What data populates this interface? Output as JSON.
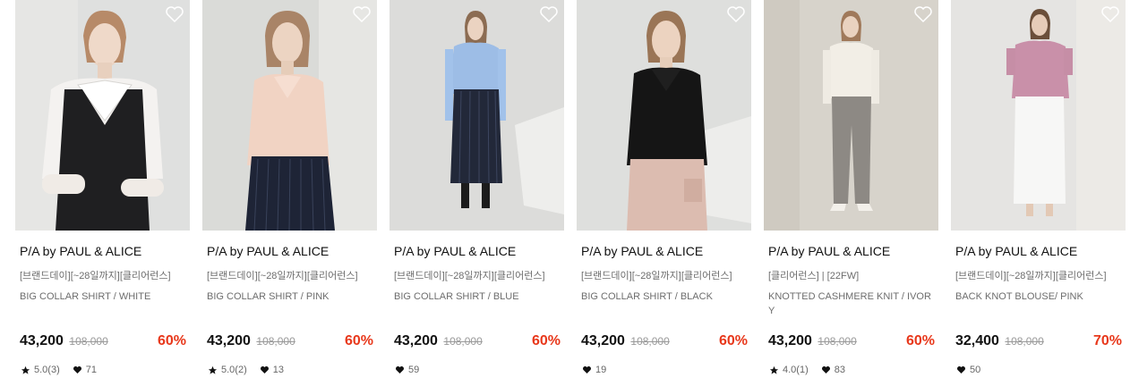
{
  "colors": {
    "discount": "#e8381b",
    "text_primary": "#111111",
    "text_secondary": "#6d6d6d",
    "strike": "#9a9a9a"
  },
  "icons": {
    "wishlist": "heart-outline-icon",
    "rating": "star-icon",
    "likes": "heart-icon"
  },
  "products": [
    {
      "brand": "P/A by PAUL & ALICE",
      "tag": "[브랜드데이][~28일까지][클리어런스]",
      "name": "BIG COLLAR SHIRT / WHITE",
      "price": "43,200",
      "original_price": "108,000",
      "discount": "60%",
      "rating": "5.0(3)",
      "likes": "71"
    },
    {
      "brand": "P/A by PAUL & ALICE",
      "tag": "[브랜드데이][~28일까지][클리어런스]",
      "name": "BIG COLLAR SHIRT / PINK",
      "price": "43,200",
      "original_price": "108,000",
      "discount": "60%",
      "rating": "5.0(2)",
      "likes": "13"
    },
    {
      "brand": "P/A by PAUL & ALICE",
      "tag": "[브랜드데이][~28일까지][클리어런스]",
      "name": "BIG COLLAR SHIRT / BLUE",
      "price": "43,200",
      "original_price": "108,000",
      "discount": "60%",
      "rating": "",
      "likes": "59"
    },
    {
      "brand": "P/A by PAUL & ALICE",
      "tag": "[브랜드데이][~28일까지][클리어런스]",
      "name": "BIG COLLAR SHIRT / BLACK",
      "price": "43,200",
      "original_price": "108,000",
      "discount": "60%",
      "rating": "",
      "likes": "19"
    },
    {
      "brand": "P/A by PAUL & ALICE",
      "tag": "[클리어런스] | [22FW]",
      "name": "KNOTTED CASHMERE KNIT / IVORY",
      "price": "43,200",
      "original_price": "108,000",
      "discount": "60%",
      "rating": "4.0(1)",
      "likes": "83"
    },
    {
      "brand": "P/A by PAUL & ALICE",
      "tag": "[브랜드데이][~28일까지][클리어런스]",
      "name": "BACK KNOT BLOUSE/ PINK",
      "price": "32,400",
      "original_price": "108,000",
      "discount": "70%",
      "rating": "",
      "likes": "50"
    }
  ]
}
